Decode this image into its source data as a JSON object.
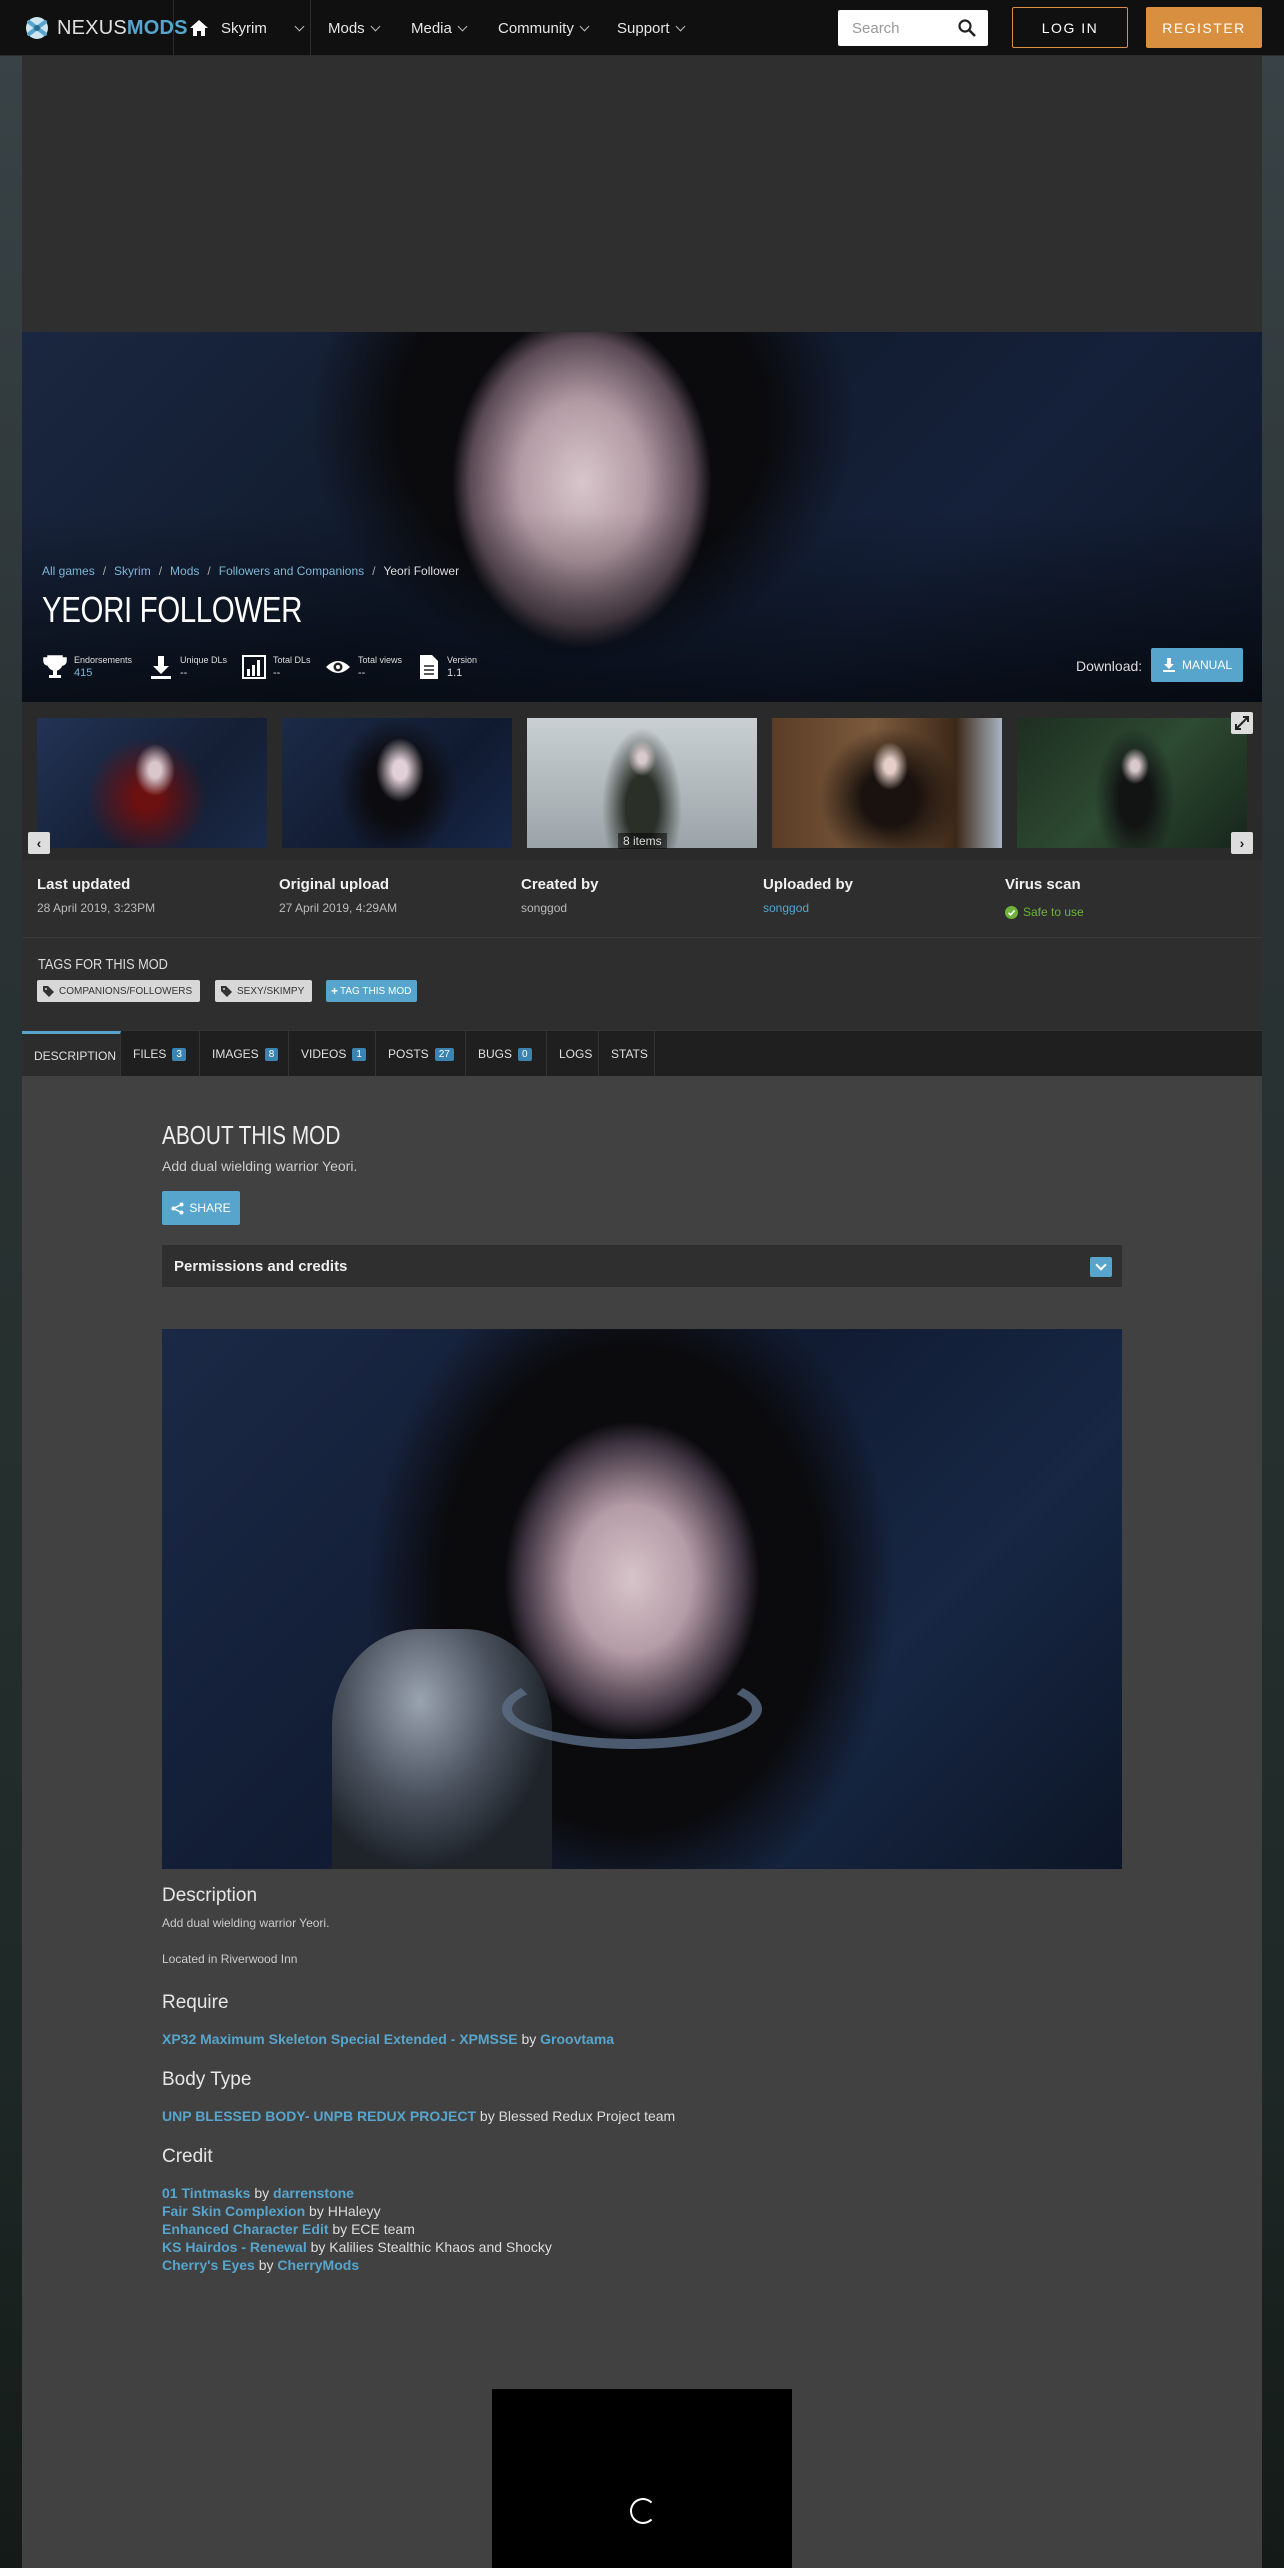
{
  "header": {
    "logo_prefix": "NEXUS",
    "logo_suffix": "MODS",
    "game": "Skyrim",
    "nav": [
      "Mods",
      "Media",
      "Community",
      "Support"
    ],
    "search_placeholder": "Search",
    "login": "LOG IN",
    "register": "REGISTER"
  },
  "breadcrumb": [
    "All games",
    "Skyrim",
    "Mods",
    "Followers and Companions",
    "Yeori Follower"
  ],
  "mod": {
    "title": "YEORI FOLLOWER",
    "stats": [
      {
        "label": "Endorsements",
        "value": "415"
      },
      {
        "label": "Unique DLs",
        "value": "--"
      },
      {
        "label": "Total DLs",
        "value": "--"
      },
      {
        "label": "Total views",
        "value": "--"
      },
      {
        "label": "Version",
        "value": "1.1"
      }
    ],
    "download_label": "Download:",
    "manual_button": "MANUAL"
  },
  "gallery": {
    "items_count": "8 items"
  },
  "info": [
    {
      "heading": "Last updated",
      "value": "28 April 2019,  3:23PM"
    },
    {
      "heading": "Original upload",
      "value": "27 April 2019,  4:29AM"
    },
    {
      "heading": "Created by",
      "value": "songgod"
    },
    {
      "heading": "Uploaded by",
      "value": "songgod"
    },
    {
      "heading": "Virus scan",
      "value": "Safe to use"
    }
  ],
  "tags": {
    "title": "TAGS FOR THIS MOD",
    "items": [
      "COMPANIONS/FOLLOWERS",
      "SEXY/SKIMPY"
    ],
    "add_button": "TAG THIS MOD"
  },
  "tabs": [
    {
      "label": "DESCRIPTION",
      "count": ""
    },
    {
      "label": "FILES",
      "count": "3"
    },
    {
      "label": "IMAGES",
      "count": "8"
    },
    {
      "label": "VIDEOS",
      "count": "1"
    },
    {
      "label": "POSTS",
      "count": "27"
    },
    {
      "label": "BUGS",
      "count": "0"
    },
    {
      "label": "LOGS",
      "count": ""
    },
    {
      "label": "STATS",
      "count": ""
    }
  ],
  "about": {
    "title": "ABOUT THIS MOD",
    "subtitle": "Add dual wielding warrior Yeori.",
    "share": "SHARE",
    "permissions": "Permissions and credits"
  },
  "description": {
    "heading": "Description",
    "line1": "Add dual wielding warrior Yeori.",
    "line2": "Located in Riverwood Inn",
    "require_heading": "Require",
    "require_link": "XP32 Maximum Skeleton Special Extended - XPMSSE",
    "require_by": " by ",
    "require_author": "Groovtama",
    "body_heading": "Body Type",
    "body_link": "UNP BLESSED BODY- UNPB REDUX PROJECT",
    "body_rest": "  by Blessed Redux Project team",
    "credit_heading": "Credit",
    "credits": [
      {
        "link": "01 Tintmasks",
        "mid": " by  ",
        "author": "darrenstone",
        "rest": ""
      },
      {
        "link": "Fair Skin Complexion",
        "mid": " by HHaleyy",
        "author": "",
        "rest": ""
      },
      {
        "link": "Enhanced Character Edit",
        "mid": " by ECE team",
        "author": "",
        "rest": ""
      },
      {
        "link": "KS Hairdos - Renewal",
        "mid": " by Kalilies Stealthic Khaos and Shocky",
        "author": "",
        "rest": ""
      },
      {
        "link": "Cherry's Eyes",
        "mid": " by  ",
        "author": "CherryMods",
        "rest": ""
      }
    ]
  }
}
